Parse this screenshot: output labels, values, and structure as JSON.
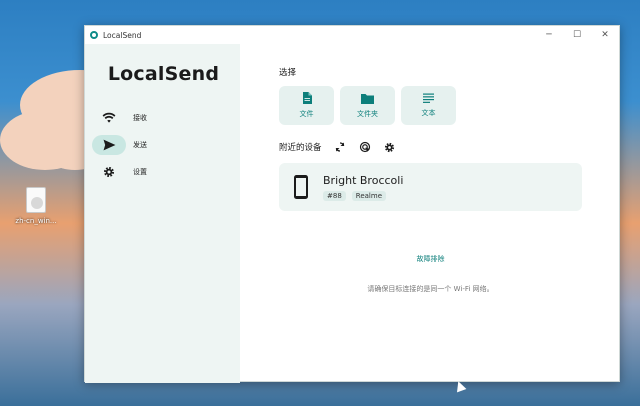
{
  "desktop": {
    "icon_label": "zh-cn_win..."
  },
  "window": {
    "title": "LocalSend",
    "controls": {
      "minimize": "─",
      "maximize": "☐",
      "close": "✕"
    }
  },
  "sidebar": {
    "brand": "LocalSend",
    "items": [
      {
        "label": "接收",
        "icon": "wifi-icon",
        "active": false
      },
      {
        "label": "发送",
        "icon": "send-icon",
        "active": true
      },
      {
        "label": "设置",
        "icon": "gear-icon",
        "active": false
      }
    ]
  },
  "main": {
    "select_title": "选择",
    "pick_options": [
      {
        "label": "文件",
        "icon": "file-icon"
      },
      {
        "label": "文件夹",
        "icon": "folder-icon"
      },
      {
        "label": "文本",
        "icon": "text-icon"
      }
    ],
    "nearby_title": "附近的设备",
    "device": {
      "name": "Bright Broccoli",
      "tags": [
        "#88",
        "Realme"
      ]
    },
    "troubleshoot": "故障排除",
    "hint": "请确保目标连接的是同一个 Wi-Fi 网络。"
  },
  "colors": {
    "accent": "#0d7f7b",
    "sidebar_bg": "#eef5f3",
    "active_pill": "#c9e7e2"
  }
}
